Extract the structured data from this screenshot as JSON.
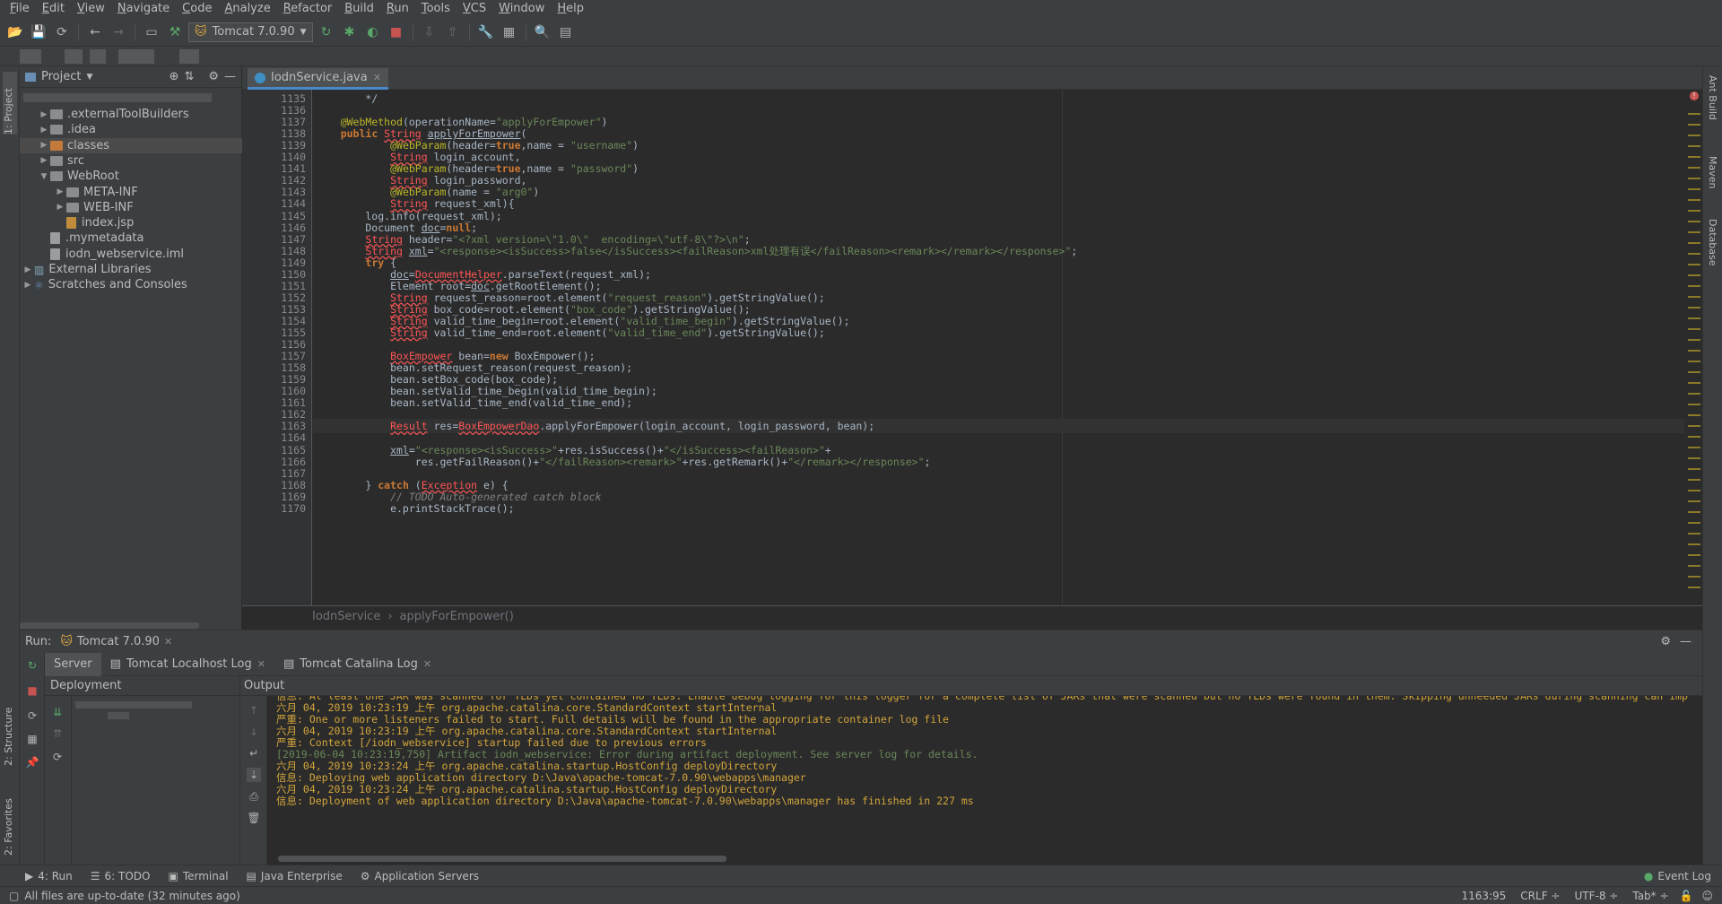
{
  "menu": [
    "File",
    "Edit",
    "View",
    "Navigate",
    "Code",
    "Analyze",
    "Refactor",
    "Build",
    "Run",
    "Tools",
    "VCS",
    "Window",
    "Help"
  ],
  "toolbar": {
    "run_config": "Tomcat 7.0.90"
  },
  "left_stripe": {
    "project": "1: Project",
    "structure": "2: Structure",
    "favorites": "2: Favorites"
  },
  "right_stripe": {
    "ant": "Ant Build",
    "maven": "Maven",
    "database": "Database"
  },
  "project": {
    "title": "Project",
    "tree": [
      {
        "label": ".externalToolBuilders",
        "indent": 1,
        "kind": "folder",
        "arrow": "▶"
      },
      {
        "label": ".idea",
        "indent": 1,
        "kind": "folder",
        "arrow": "▶"
      },
      {
        "label": "classes",
        "indent": 1,
        "kind": "folder-orange",
        "arrow": "▶",
        "selected": true
      },
      {
        "label": "src",
        "indent": 1,
        "kind": "folder",
        "arrow": "▶"
      },
      {
        "label": "WebRoot",
        "indent": 1,
        "kind": "folder",
        "arrow": "▼"
      },
      {
        "label": "META-INF",
        "indent": 2,
        "kind": "folder",
        "arrow": "▶"
      },
      {
        "label": "WEB-INF",
        "indent": 2,
        "kind": "folder",
        "arrow": "▶"
      },
      {
        "label": "index.jsp",
        "indent": 2,
        "kind": "jsp",
        "arrow": ""
      },
      {
        "label": ".mymetadata",
        "indent": 1,
        "kind": "file",
        "arrow": ""
      },
      {
        "label": "iodn_webservice.iml",
        "indent": 1,
        "kind": "file",
        "arrow": ""
      },
      {
        "label": "External Libraries",
        "indent": 0,
        "kind": "lib",
        "arrow": "▶"
      },
      {
        "label": "Scratches and Consoles",
        "indent": 0,
        "kind": "scratch",
        "arrow": "▶"
      }
    ]
  },
  "editor": {
    "tab": "IodnService.java",
    "first_line": 1135,
    "current_line": 1163,
    "breadcrumb": [
      "IodnService",
      "applyForEmpower()"
    ],
    "lines": [
      [
        [
          "t",
          "        */"
        ]
      ],
      [],
      [
        [
          "t",
          "    "
        ],
        [
          "ann",
          "@WebMethod"
        ],
        [
          "t",
          "(operationName="
        ],
        [
          "str",
          "\"applyForEmpower\""
        ],
        [
          "t",
          ")"
        ]
      ],
      [
        [
          "t",
          "    "
        ],
        [
          "kw",
          "public "
        ],
        [
          "err",
          "String"
        ],
        [
          "t",
          " "
        ],
        [
          "und",
          "applyForEmpower"
        ],
        [
          "t",
          "("
        ]
      ],
      [
        [
          "t",
          "            "
        ],
        [
          "ann",
          "@WebParam"
        ],
        [
          "t",
          "(header="
        ],
        [
          "kw",
          "true"
        ],
        [
          "t",
          ",name = "
        ],
        [
          "str",
          "\"username\""
        ],
        [
          "t",
          ")"
        ]
      ],
      [
        [
          "t",
          "            "
        ],
        [
          "err",
          "String"
        ],
        [
          "t",
          " login_account,"
        ]
      ],
      [
        [
          "t",
          "            "
        ],
        [
          "ann",
          "@WebParam"
        ],
        [
          "t",
          "(header="
        ],
        [
          "kw",
          "true"
        ],
        [
          "t",
          ",name = "
        ],
        [
          "str",
          "\"password\""
        ],
        [
          "t",
          ")"
        ]
      ],
      [
        [
          "t",
          "            "
        ],
        [
          "err",
          "String"
        ],
        [
          "t",
          " login_password,"
        ]
      ],
      [
        [
          "t",
          "            "
        ],
        [
          "ann",
          "@WebParam"
        ],
        [
          "t",
          "(name = "
        ],
        [
          "str",
          "\"arg0\""
        ],
        [
          "t",
          ")"
        ]
      ],
      [
        [
          "t",
          "            "
        ],
        [
          "err",
          "String"
        ],
        [
          "t",
          " request_xml){"
        ]
      ],
      [
        [
          "t",
          "        log.info(request_xml);"
        ]
      ],
      [
        [
          "t",
          "        Document "
        ],
        [
          "und",
          "doc"
        ],
        [
          "t",
          "="
        ],
        [
          "kw",
          "null"
        ],
        [
          "t",
          ";"
        ]
      ],
      [
        [
          "t",
          "        "
        ],
        [
          "err",
          "String"
        ],
        [
          "t",
          " header="
        ],
        [
          "str",
          "\"<?xml version=\\\"1.0\\\"  encoding=\\\"utf-8\\\"?>\\n\""
        ],
        [
          "t",
          ";"
        ]
      ],
      [
        [
          "t",
          "        "
        ],
        [
          "err",
          "String"
        ],
        [
          "t",
          " "
        ],
        [
          "und",
          "xml"
        ],
        [
          "t",
          "="
        ],
        [
          "str",
          "\"<response><isSuccess>false</isSuccess><failReason>xml处理有误</failReason><remark></remark></response>\""
        ],
        [
          "t",
          ";"
        ]
      ],
      [
        [
          "t",
          "        "
        ],
        [
          "kw",
          "try"
        ],
        [
          "t",
          " {"
        ]
      ],
      [
        [
          "t",
          "            "
        ],
        [
          "und",
          "doc"
        ],
        [
          "t",
          "="
        ],
        [
          "err",
          "DocumentHelper"
        ],
        [
          "t",
          ".parseText(request_xml);"
        ]
      ],
      [
        [
          "t",
          "            Element root="
        ],
        [
          "und",
          "doc"
        ],
        [
          "t",
          ".getRootElement();"
        ]
      ],
      [
        [
          "t",
          "            "
        ],
        [
          "err",
          "String"
        ],
        [
          "t",
          " request_reason=root.element("
        ],
        [
          "str",
          "\"request_reason\""
        ],
        [
          "t",
          ").getStringValue();"
        ]
      ],
      [
        [
          "t",
          "            "
        ],
        [
          "err",
          "String"
        ],
        [
          "t",
          " box_code=root.element("
        ],
        [
          "str",
          "\"box_code\""
        ],
        [
          "t",
          ").getStringValue();"
        ]
      ],
      [
        [
          "t",
          "            "
        ],
        [
          "err",
          "String"
        ],
        [
          "t",
          " valid_time_begin=root.element("
        ],
        [
          "str",
          "\"valid_time_begin\""
        ],
        [
          "t",
          ").getStringValue();"
        ]
      ],
      [
        [
          "t",
          "            "
        ],
        [
          "err",
          "String"
        ],
        [
          "t",
          " valid_time_end=root.element("
        ],
        [
          "str",
          "\"valid_time_end\""
        ],
        [
          "t",
          ").getStringValue();"
        ]
      ],
      [],
      [
        [
          "t",
          "            "
        ],
        [
          "err",
          "BoxEmpower"
        ],
        [
          "t",
          " bean="
        ],
        [
          "kw",
          "new "
        ],
        [
          "t",
          "BoxEmpower();"
        ]
      ],
      [
        [
          "t",
          "            bean.setRequest_reason(request_reason);"
        ]
      ],
      [
        [
          "t",
          "            bean.setBox_code(box_code);"
        ]
      ],
      [
        [
          "t",
          "            bean.setValid_time_begin(valid_time_begin);"
        ]
      ],
      [
        [
          "t",
          "            bean.setValid_time_end(valid_time_end);"
        ]
      ],
      [],
      [
        [
          "t",
          "            "
        ],
        [
          "err",
          "Result"
        ],
        [
          "t",
          " res="
        ],
        [
          "err",
          "BoxEmpowerDao"
        ],
        [
          "t",
          ".applyForEmpower(login_account, login_password, bean);"
        ]
      ],
      [],
      [
        [
          "t",
          "            "
        ],
        [
          "und",
          "xml"
        ],
        [
          "t",
          "="
        ],
        [
          "str",
          "\"<response><isSuccess>\""
        ],
        [
          "t",
          "+res.isSuccess()+"
        ],
        [
          "str",
          "\"</isSuccess><failReason>\""
        ],
        [
          "t",
          "+"
        ]
      ],
      [
        [
          "t",
          "                res.getFailReason()+"
        ],
        [
          "str",
          "\"</failReason><remark>\""
        ],
        [
          "t",
          "+res.getRemark()+"
        ],
        [
          "str",
          "\"</remark></response>\""
        ],
        [
          "t",
          ";"
        ]
      ],
      [],
      [
        [
          "t",
          "        } "
        ],
        [
          "kw",
          "catch "
        ],
        [
          "t",
          "("
        ],
        [
          "err",
          "Exception"
        ],
        [
          "t",
          " e) {"
        ]
      ],
      [
        [
          "t",
          "            "
        ],
        [
          "cmt",
          "// TODO Auto-generated catch block"
        ]
      ],
      [
        [
          "t",
          "            e.printStackTrace();"
        ]
      ]
    ]
  },
  "run": {
    "label": "Run:",
    "config_tab": "Tomcat 7.0.90",
    "tabs": [
      "Server",
      "Tomcat Localhost Log",
      "Tomcat Catalina Log"
    ],
    "deployment_title": "Deployment",
    "output_title": "Output",
    "console": [
      {
        "text": "信息: At least one JAR was scanned for TLDs yet contained no TLDs. Enable debug logging for this logger for a complete list of JARs that were scanned but no TLDs were found in them. Skipping unneeded JARs during scanning can imp",
        "kind": "warn"
      },
      {
        "text": "六月 04, 2019 10:23:19 上午 org.apache.catalina.core.StandardContext startInternal",
        "kind": "warn"
      },
      {
        "text": "严重: One or more listeners failed to start. Full details will be found in the appropriate container log file",
        "kind": "warn"
      },
      {
        "text": "六月 04, 2019 10:23:19 上午 org.apache.catalina.core.StandardContext startInternal",
        "kind": "warn"
      },
      {
        "text": "严重: Context [/iodn_webservice] startup failed due to previous errors",
        "kind": "warn"
      },
      {
        "text": "[2019-06-04 10:23:19,750] Artifact iodn_webservice: Error during artifact deployment. See server log for details.",
        "kind": "green"
      },
      {
        "text": "六月 04, 2019 10:23:24 上午 org.apache.catalina.startup.HostConfig deployDirectory",
        "kind": "warn"
      },
      {
        "text": "信息: Deploying web application directory D:\\Java\\apache-tomcat-7.0.90\\webapps\\manager",
        "kind": "warn"
      },
      {
        "text": "六月 04, 2019 10:23:24 上午 org.apache.catalina.startup.HostConfig deployDirectory",
        "kind": "warn"
      },
      {
        "text": "信息: Deployment of web application directory D:\\Java\\apache-tomcat-7.0.90\\webapps\\manager has finished in 227 ms",
        "kind": "warn"
      }
    ]
  },
  "tool_windows": [
    {
      "label": "4: Run",
      "icon": "▶"
    },
    {
      "label": "6: TODO",
      "icon": "☰"
    },
    {
      "label": "Terminal",
      "icon": "▣"
    },
    {
      "label": "Java Enterprise",
      "icon": "▤"
    },
    {
      "label": "Application Servers",
      "icon": "⚙"
    }
  ],
  "event_log": "Event Log",
  "status": {
    "message": "All files are up-to-date (32 minutes ago)",
    "position": "1163:95",
    "line_sep": "CRLF ÷",
    "encoding": "UTF-8 ÷",
    "indent": "Tab* ÷"
  },
  "colors": {
    "accent": "#4a88c7",
    "keyword": "#cc7832",
    "string": "#6a8759",
    "annotation": "#bbb529",
    "error": "#ff5555",
    "console": "#d3a53b"
  }
}
